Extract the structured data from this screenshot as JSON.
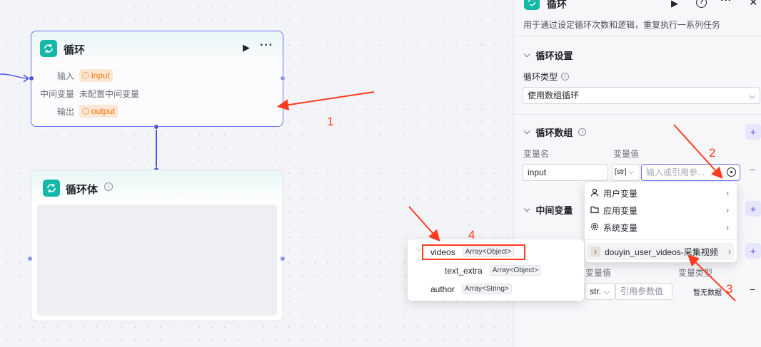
{
  "canvas": {
    "loop_node": {
      "title": "循环",
      "input_label": "输入",
      "input_value": "input",
      "mid_label": "中间变量",
      "mid_value": "未配置中间变量",
      "output_label": "输出",
      "output_value": "output"
    },
    "loop_body_node": {
      "title": "循环体"
    }
  },
  "panel": {
    "title": "循环",
    "description": "用于通过设定循环次数和逻辑，重复执行一系列任务",
    "loop_settings": {
      "title": "循环设置",
      "type_label": "循环类型",
      "type_value": "使用数组循环"
    },
    "loop_array": {
      "title": "循环数组",
      "col_name": "变量名",
      "col_value": "变量值",
      "name_value": "input",
      "type_value": "[str]",
      "value_placeholder": "输入或引用参..."
    },
    "mid_vars": {
      "title": "中间变量"
    },
    "output_section": {
      "col_value": "变量值",
      "col_type": "变量类型",
      "type_value": "str.",
      "value_placeholder": "引用参数值",
      "no_data": "暂无数据"
    }
  },
  "ref_menu": {
    "items": [
      {
        "label": "用户变量",
        "icon": "user-icon"
      },
      {
        "label": "应用变量",
        "icon": "folder-icon"
      },
      {
        "label": "系统变量",
        "icon": "gear-icon"
      }
    ],
    "source_node": "douyin_user_videos-采集视频"
  },
  "field_popup": {
    "fields": [
      {
        "name": "videos",
        "type": "Array<Object>"
      },
      {
        "name": "text_extra",
        "type": "Array<Object>"
      },
      {
        "name": "author",
        "type": "Array<String>"
      }
    ]
  },
  "annotations": {
    "n1": "1",
    "n2": "2",
    "n3": "3",
    "n4": "4"
  },
  "colors": {
    "accent": "#4d53e8",
    "node_icon": "#14b8a6",
    "annotation": "#ff3b1f",
    "output_tag": "#f5760a"
  }
}
